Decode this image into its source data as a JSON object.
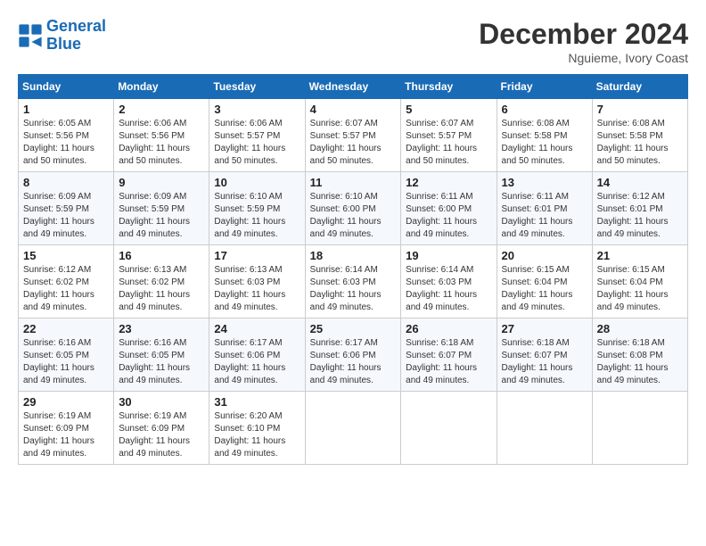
{
  "logo": {
    "line1": "General",
    "line2": "Blue"
  },
  "title": "December 2024",
  "location": "Nguieme, Ivory Coast",
  "days_of_week": [
    "Sunday",
    "Monday",
    "Tuesday",
    "Wednesday",
    "Thursday",
    "Friday",
    "Saturday"
  ],
  "weeks": [
    [
      {
        "day": "1",
        "sunrise": "6:05 AM",
        "sunset": "5:56 PM",
        "daylight": "11 hours and 50 minutes."
      },
      {
        "day": "2",
        "sunrise": "6:06 AM",
        "sunset": "5:56 PM",
        "daylight": "11 hours and 50 minutes."
      },
      {
        "day": "3",
        "sunrise": "6:06 AM",
        "sunset": "5:57 PM",
        "daylight": "11 hours and 50 minutes."
      },
      {
        "day": "4",
        "sunrise": "6:07 AM",
        "sunset": "5:57 PM",
        "daylight": "11 hours and 50 minutes."
      },
      {
        "day": "5",
        "sunrise": "6:07 AM",
        "sunset": "5:57 PM",
        "daylight": "11 hours and 50 minutes."
      },
      {
        "day": "6",
        "sunrise": "6:08 AM",
        "sunset": "5:58 PM",
        "daylight": "11 hours and 50 minutes."
      },
      {
        "day": "7",
        "sunrise": "6:08 AM",
        "sunset": "5:58 PM",
        "daylight": "11 hours and 50 minutes."
      }
    ],
    [
      {
        "day": "8",
        "sunrise": "6:09 AM",
        "sunset": "5:59 PM",
        "daylight": "11 hours and 49 minutes."
      },
      {
        "day": "9",
        "sunrise": "6:09 AM",
        "sunset": "5:59 PM",
        "daylight": "11 hours and 49 minutes."
      },
      {
        "day": "10",
        "sunrise": "6:10 AM",
        "sunset": "5:59 PM",
        "daylight": "11 hours and 49 minutes."
      },
      {
        "day": "11",
        "sunrise": "6:10 AM",
        "sunset": "6:00 PM",
        "daylight": "11 hours and 49 minutes."
      },
      {
        "day": "12",
        "sunrise": "6:11 AM",
        "sunset": "6:00 PM",
        "daylight": "11 hours and 49 minutes."
      },
      {
        "day": "13",
        "sunrise": "6:11 AM",
        "sunset": "6:01 PM",
        "daylight": "11 hours and 49 minutes."
      },
      {
        "day": "14",
        "sunrise": "6:12 AM",
        "sunset": "6:01 PM",
        "daylight": "11 hours and 49 minutes."
      }
    ],
    [
      {
        "day": "15",
        "sunrise": "6:12 AM",
        "sunset": "6:02 PM",
        "daylight": "11 hours and 49 minutes."
      },
      {
        "day": "16",
        "sunrise": "6:13 AM",
        "sunset": "6:02 PM",
        "daylight": "11 hours and 49 minutes."
      },
      {
        "day": "17",
        "sunrise": "6:13 AM",
        "sunset": "6:03 PM",
        "daylight": "11 hours and 49 minutes."
      },
      {
        "day": "18",
        "sunrise": "6:14 AM",
        "sunset": "6:03 PM",
        "daylight": "11 hours and 49 minutes."
      },
      {
        "day": "19",
        "sunrise": "6:14 AM",
        "sunset": "6:03 PM",
        "daylight": "11 hours and 49 minutes."
      },
      {
        "day": "20",
        "sunrise": "6:15 AM",
        "sunset": "6:04 PM",
        "daylight": "11 hours and 49 minutes."
      },
      {
        "day": "21",
        "sunrise": "6:15 AM",
        "sunset": "6:04 PM",
        "daylight": "11 hours and 49 minutes."
      }
    ],
    [
      {
        "day": "22",
        "sunrise": "6:16 AM",
        "sunset": "6:05 PM",
        "daylight": "11 hours and 49 minutes."
      },
      {
        "day": "23",
        "sunrise": "6:16 AM",
        "sunset": "6:05 PM",
        "daylight": "11 hours and 49 minutes."
      },
      {
        "day": "24",
        "sunrise": "6:17 AM",
        "sunset": "6:06 PM",
        "daylight": "11 hours and 49 minutes."
      },
      {
        "day": "25",
        "sunrise": "6:17 AM",
        "sunset": "6:06 PM",
        "daylight": "11 hours and 49 minutes."
      },
      {
        "day": "26",
        "sunrise": "6:18 AM",
        "sunset": "6:07 PM",
        "daylight": "11 hours and 49 minutes."
      },
      {
        "day": "27",
        "sunrise": "6:18 AM",
        "sunset": "6:07 PM",
        "daylight": "11 hours and 49 minutes."
      },
      {
        "day": "28",
        "sunrise": "6:18 AM",
        "sunset": "6:08 PM",
        "daylight": "11 hours and 49 minutes."
      }
    ],
    [
      {
        "day": "29",
        "sunrise": "6:19 AM",
        "sunset": "6:09 PM",
        "daylight": "11 hours and 49 minutes."
      },
      {
        "day": "30",
        "sunrise": "6:19 AM",
        "sunset": "6:09 PM",
        "daylight": "11 hours and 49 minutes."
      },
      {
        "day": "31",
        "sunrise": "6:20 AM",
        "sunset": "6:10 PM",
        "daylight": "11 hours and 49 minutes."
      },
      null,
      null,
      null,
      null
    ]
  ]
}
